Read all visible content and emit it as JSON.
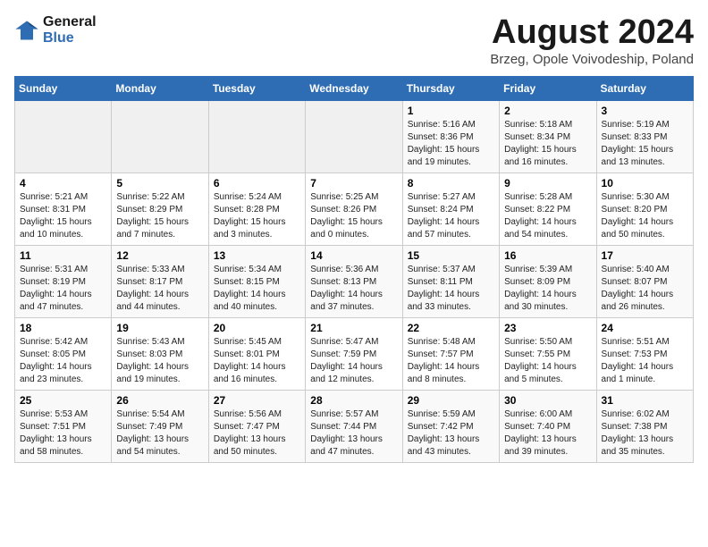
{
  "header": {
    "logo_line1": "General",
    "logo_line2": "Blue",
    "month_year": "August 2024",
    "location": "Brzeg, Opole Voivodeship, Poland"
  },
  "weekdays": [
    "Sunday",
    "Monday",
    "Tuesday",
    "Wednesday",
    "Thursday",
    "Friday",
    "Saturday"
  ],
  "weeks": [
    [
      {
        "day": "",
        "info": ""
      },
      {
        "day": "",
        "info": ""
      },
      {
        "day": "",
        "info": ""
      },
      {
        "day": "",
        "info": ""
      },
      {
        "day": "1",
        "info": "Sunrise: 5:16 AM\nSunset: 8:36 PM\nDaylight: 15 hours\nand 19 minutes."
      },
      {
        "day": "2",
        "info": "Sunrise: 5:18 AM\nSunset: 8:34 PM\nDaylight: 15 hours\nand 16 minutes."
      },
      {
        "day": "3",
        "info": "Sunrise: 5:19 AM\nSunset: 8:33 PM\nDaylight: 15 hours\nand 13 minutes."
      }
    ],
    [
      {
        "day": "4",
        "info": "Sunrise: 5:21 AM\nSunset: 8:31 PM\nDaylight: 15 hours\nand 10 minutes."
      },
      {
        "day": "5",
        "info": "Sunrise: 5:22 AM\nSunset: 8:29 PM\nDaylight: 15 hours\nand 7 minutes."
      },
      {
        "day": "6",
        "info": "Sunrise: 5:24 AM\nSunset: 8:28 PM\nDaylight: 15 hours\nand 3 minutes."
      },
      {
        "day": "7",
        "info": "Sunrise: 5:25 AM\nSunset: 8:26 PM\nDaylight: 15 hours\nand 0 minutes."
      },
      {
        "day": "8",
        "info": "Sunrise: 5:27 AM\nSunset: 8:24 PM\nDaylight: 14 hours\nand 57 minutes."
      },
      {
        "day": "9",
        "info": "Sunrise: 5:28 AM\nSunset: 8:22 PM\nDaylight: 14 hours\nand 54 minutes."
      },
      {
        "day": "10",
        "info": "Sunrise: 5:30 AM\nSunset: 8:20 PM\nDaylight: 14 hours\nand 50 minutes."
      }
    ],
    [
      {
        "day": "11",
        "info": "Sunrise: 5:31 AM\nSunset: 8:19 PM\nDaylight: 14 hours\nand 47 minutes."
      },
      {
        "day": "12",
        "info": "Sunrise: 5:33 AM\nSunset: 8:17 PM\nDaylight: 14 hours\nand 44 minutes."
      },
      {
        "day": "13",
        "info": "Sunrise: 5:34 AM\nSunset: 8:15 PM\nDaylight: 14 hours\nand 40 minutes."
      },
      {
        "day": "14",
        "info": "Sunrise: 5:36 AM\nSunset: 8:13 PM\nDaylight: 14 hours\nand 37 minutes."
      },
      {
        "day": "15",
        "info": "Sunrise: 5:37 AM\nSunset: 8:11 PM\nDaylight: 14 hours\nand 33 minutes."
      },
      {
        "day": "16",
        "info": "Sunrise: 5:39 AM\nSunset: 8:09 PM\nDaylight: 14 hours\nand 30 minutes."
      },
      {
        "day": "17",
        "info": "Sunrise: 5:40 AM\nSunset: 8:07 PM\nDaylight: 14 hours\nand 26 minutes."
      }
    ],
    [
      {
        "day": "18",
        "info": "Sunrise: 5:42 AM\nSunset: 8:05 PM\nDaylight: 14 hours\nand 23 minutes."
      },
      {
        "day": "19",
        "info": "Sunrise: 5:43 AM\nSunset: 8:03 PM\nDaylight: 14 hours\nand 19 minutes."
      },
      {
        "day": "20",
        "info": "Sunrise: 5:45 AM\nSunset: 8:01 PM\nDaylight: 14 hours\nand 16 minutes."
      },
      {
        "day": "21",
        "info": "Sunrise: 5:47 AM\nSunset: 7:59 PM\nDaylight: 14 hours\nand 12 minutes."
      },
      {
        "day": "22",
        "info": "Sunrise: 5:48 AM\nSunset: 7:57 PM\nDaylight: 14 hours\nand 8 minutes."
      },
      {
        "day": "23",
        "info": "Sunrise: 5:50 AM\nSunset: 7:55 PM\nDaylight: 14 hours\nand 5 minutes."
      },
      {
        "day": "24",
        "info": "Sunrise: 5:51 AM\nSunset: 7:53 PM\nDaylight: 14 hours\nand 1 minute."
      }
    ],
    [
      {
        "day": "25",
        "info": "Sunrise: 5:53 AM\nSunset: 7:51 PM\nDaylight: 13 hours\nand 58 minutes."
      },
      {
        "day": "26",
        "info": "Sunrise: 5:54 AM\nSunset: 7:49 PM\nDaylight: 13 hours\nand 54 minutes."
      },
      {
        "day": "27",
        "info": "Sunrise: 5:56 AM\nSunset: 7:47 PM\nDaylight: 13 hours\nand 50 minutes."
      },
      {
        "day": "28",
        "info": "Sunrise: 5:57 AM\nSunset: 7:44 PM\nDaylight: 13 hours\nand 47 minutes."
      },
      {
        "day": "29",
        "info": "Sunrise: 5:59 AM\nSunset: 7:42 PM\nDaylight: 13 hours\nand 43 minutes."
      },
      {
        "day": "30",
        "info": "Sunrise: 6:00 AM\nSunset: 7:40 PM\nDaylight: 13 hours\nand 39 minutes."
      },
      {
        "day": "31",
        "info": "Sunrise: 6:02 AM\nSunset: 7:38 PM\nDaylight: 13 hours\nand 35 minutes."
      }
    ]
  ]
}
